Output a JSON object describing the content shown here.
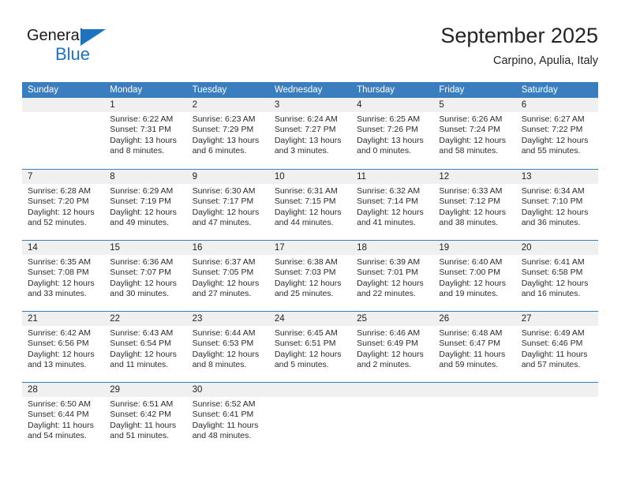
{
  "brand": {
    "name_top": "General",
    "name_bottom": "Blue",
    "accent_color": "#1f72bd"
  },
  "header": {
    "title": "September 2025",
    "subtitle": "Carpino, Apulia, Italy"
  },
  "calendar": {
    "header_bg": "#3b7ebf",
    "daynum_bg": "#f0f0f0",
    "weekdays": [
      "Sunday",
      "Monday",
      "Tuesday",
      "Wednesday",
      "Thursday",
      "Friday",
      "Saturday"
    ],
    "weeks": [
      [
        {
          "day": ""
        },
        {
          "day": "1",
          "sunrise": "Sunrise: 6:22 AM",
          "sunset": "Sunset: 7:31 PM",
          "daylight_1": "Daylight: 13 hours",
          "daylight_2": "and 8 minutes."
        },
        {
          "day": "2",
          "sunrise": "Sunrise: 6:23 AM",
          "sunset": "Sunset: 7:29 PM",
          "daylight_1": "Daylight: 13 hours",
          "daylight_2": "and 6 minutes."
        },
        {
          "day": "3",
          "sunrise": "Sunrise: 6:24 AM",
          "sunset": "Sunset: 7:27 PM",
          "daylight_1": "Daylight: 13 hours",
          "daylight_2": "and 3 minutes."
        },
        {
          "day": "4",
          "sunrise": "Sunrise: 6:25 AM",
          "sunset": "Sunset: 7:26 PM",
          "daylight_1": "Daylight: 13 hours",
          "daylight_2": "and 0 minutes."
        },
        {
          "day": "5",
          "sunrise": "Sunrise: 6:26 AM",
          "sunset": "Sunset: 7:24 PM",
          "daylight_1": "Daylight: 12 hours",
          "daylight_2": "and 58 minutes."
        },
        {
          "day": "6",
          "sunrise": "Sunrise: 6:27 AM",
          "sunset": "Sunset: 7:22 PM",
          "daylight_1": "Daylight: 12 hours",
          "daylight_2": "and 55 minutes."
        }
      ],
      [
        {
          "day": "7",
          "sunrise": "Sunrise: 6:28 AM",
          "sunset": "Sunset: 7:20 PM",
          "daylight_1": "Daylight: 12 hours",
          "daylight_2": "and 52 minutes."
        },
        {
          "day": "8",
          "sunrise": "Sunrise: 6:29 AM",
          "sunset": "Sunset: 7:19 PM",
          "daylight_1": "Daylight: 12 hours",
          "daylight_2": "and 49 minutes."
        },
        {
          "day": "9",
          "sunrise": "Sunrise: 6:30 AM",
          "sunset": "Sunset: 7:17 PM",
          "daylight_1": "Daylight: 12 hours",
          "daylight_2": "and 47 minutes."
        },
        {
          "day": "10",
          "sunrise": "Sunrise: 6:31 AM",
          "sunset": "Sunset: 7:15 PM",
          "daylight_1": "Daylight: 12 hours",
          "daylight_2": "and 44 minutes."
        },
        {
          "day": "11",
          "sunrise": "Sunrise: 6:32 AM",
          "sunset": "Sunset: 7:14 PM",
          "daylight_1": "Daylight: 12 hours",
          "daylight_2": "and 41 minutes."
        },
        {
          "day": "12",
          "sunrise": "Sunrise: 6:33 AM",
          "sunset": "Sunset: 7:12 PM",
          "daylight_1": "Daylight: 12 hours",
          "daylight_2": "and 38 minutes."
        },
        {
          "day": "13",
          "sunrise": "Sunrise: 6:34 AM",
          "sunset": "Sunset: 7:10 PM",
          "daylight_1": "Daylight: 12 hours",
          "daylight_2": "and 36 minutes."
        }
      ],
      [
        {
          "day": "14",
          "sunrise": "Sunrise: 6:35 AM",
          "sunset": "Sunset: 7:08 PM",
          "daylight_1": "Daylight: 12 hours",
          "daylight_2": "and 33 minutes."
        },
        {
          "day": "15",
          "sunrise": "Sunrise: 6:36 AM",
          "sunset": "Sunset: 7:07 PM",
          "daylight_1": "Daylight: 12 hours",
          "daylight_2": "and 30 minutes."
        },
        {
          "day": "16",
          "sunrise": "Sunrise: 6:37 AM",
          "sunset": "Sunset: 7:05 PM",
          "daylight_1": "Daylight: 12 hours",
          "daylight_2": "and 27 minutes."
        },
        {
          "day": "17",
          "sunrise": "Sunrise: 6:38 AM",
          "sunset": "Sunset: 7:03 PM",
          "daylight_1": "Daylight: 12 hours",
          "daylight_2": "and 25 minutes."
        },
        {
          "day": "18",
          "sunrise": "Sunrise: 6:39 AM",
          "sunset": "Sunset: 7:01 PM",
          "daylight_1": "Daylight: 12 hours",
          "daylight_2": "and 22 minutes."
        },
        {
          "day": "19",
          "sunrise": "Sunrise: 6:40 AM",
          "sunset": "Sunset: 7:00 PM",
          "daylight_1": "Daylight: 12 hours",
          "daylight_2": "and 19 minutes."
        },
        {
          "day": "20",
          "sunrise": "Sunrise: 6:41 AM",
          "sunset": "Sunset: 6:58 PM",
          "daylight_1": "Daylight: 12 hours",
          "daylight_2": "and 16 minutes."
        }
      ],
      [
        {
          "day": "21",
          "sunrise": "Sunrise: 6:42 AM",
          "sunset": "Sunset: 6:56 PM",
          "daylight_1": "Daylight: 12 hours",
          "daylight_2": "and 13 minutes."
        },
        {
          "day": "22",
          "sunrise": "Sunrise: 6:43 AM",
          "sunset": "Sunset: 6:54 PM",
          "daylight_1": "Daylight: 12 hours",
          "daylight_2": "and 11 minutes."
        },
        {
          "day": "23",
          "sunrise": "Sunrise: 6:44 AM",
          "sunset": "Sunset: 6:53 PM",
          "daylight_1": "Daylight: 12 hours",
          "daylight_2": "and 8 minutes."
        },
        {
          "day": "24",
          "sunrise": "Sunrise: 6:45 AM",
          "sunset": "Sunset: 6:51 PM",
          "daylight_1": "Daylight: 12 hours",
          "daylight_2": "and 5 minutes."
        },
        {
          "day": "25",
          "sunrise": "Sunrise: 6:46 AM",
          "sunset": "Sunset: 6:49 PM",
          "daylight_1": "Daylight: 12 hours",
          "daylight_2": "and 2 minutes."
        },
        {
          "day": "26",
          "sunrise": "Sunrise: 6:48 AM",
          "sunset": "Sunset: 6:47 PM",
          "daylight_1": "Daylight: 11 hours",
          "daylight_2": "and 59 minutes."
        },
        {
          "day": "27",
          "sunrise": "Sunrise: 6:49 AM",
          "sunset": "Sunset: 6:46 PM",
          "daylight_1": "Daylight: 11 hours",
          "daylight_2": "and 57 minutes."
        }
      ],
      [
        {
          "day": "28",
          "sunrise": "Sunrise: 6:50 AM",
          "sunset": "Sunset: 6:44 PM",
          "daylight_1": "Daylight: 11 hours",
          "daylight_2": "and 54 minutes."
        },
        {
          "day": "29",
          "sunrise": "Sunrise: 6:51 AM",
          "sunset": "Sunset: 6:42 PM",
          "daylight_1": "Daylight: 11 hours",
          "daylight_2": "and 51 minutes."
        },
        {
          "day": "30",
          "sunrise": "Sunrise: 6:52 AM",
          "sunset": "Sunset: 6:41 PM",
          "daylight_1": "Daylight: 11 hours",
          "daylight_2": "and 48 minutes."
        },
        {
          "day": ""
        },
        {
          "day": ""
        },
        {
          "day": ""
        },
        {
          "day": ""
        }
      ]
    ]
  }
}
